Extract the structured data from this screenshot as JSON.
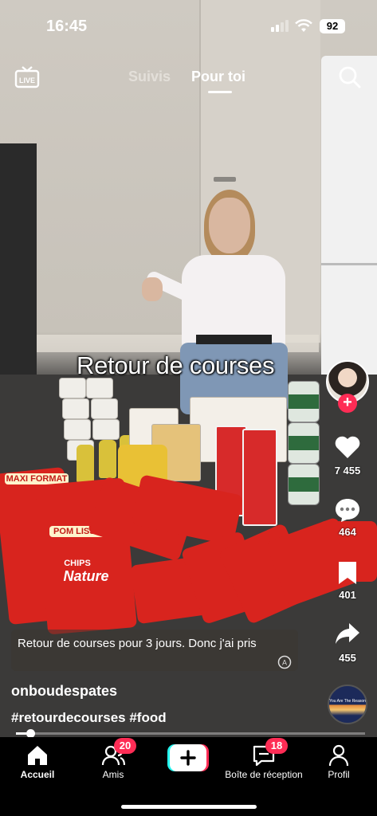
{
  "status_bar": {
    "time": "16:45",
    "battery": "92"
  },
  "top_nav": {
    "live_label": "LIVE",
    "tabs": [
      {
        "label": "Suivis"
      },
      {
        "label": "Pour toi"
      }
    ]
  },
  "video": {
    "overlay_text": "Retour de courses"
  },
  "side_actions": {
    "likes": "7 455",
    "comments": "464",
    "saves": "401",
    "shares": "455"
  },
  "post": {
    "caption": "Retour de courses pour 3 jours. Donc j'ai pris",
    "username": "onboudespates",
    "hashtags": "#retourdecourses #food",
    "music_cover_text": "You Are The Reason"
  },
  "playback": {
    "progress": 0.03
  },
  "bottom_nav": {
    "items": [
      {
        "label": "Accueil"
      },
      {
        "label": "Amis",
        "badge": "20"
      },
      {
        "label": "Boîte de réception",
        "badge": "18"
      },
      {
        "label": "Profil"
      }
    ]
  },
  "products": {
    "chips_brand": "POM LISSE",
    "chips_variant": "CHIPS",
    "chips_type": "Nature",
    "chips_maxi": "MAXI FORMAT"
  },
  "colors": {
    "accent": "#fe2c55",
    "nav_bg": "#000000"
  }
}
